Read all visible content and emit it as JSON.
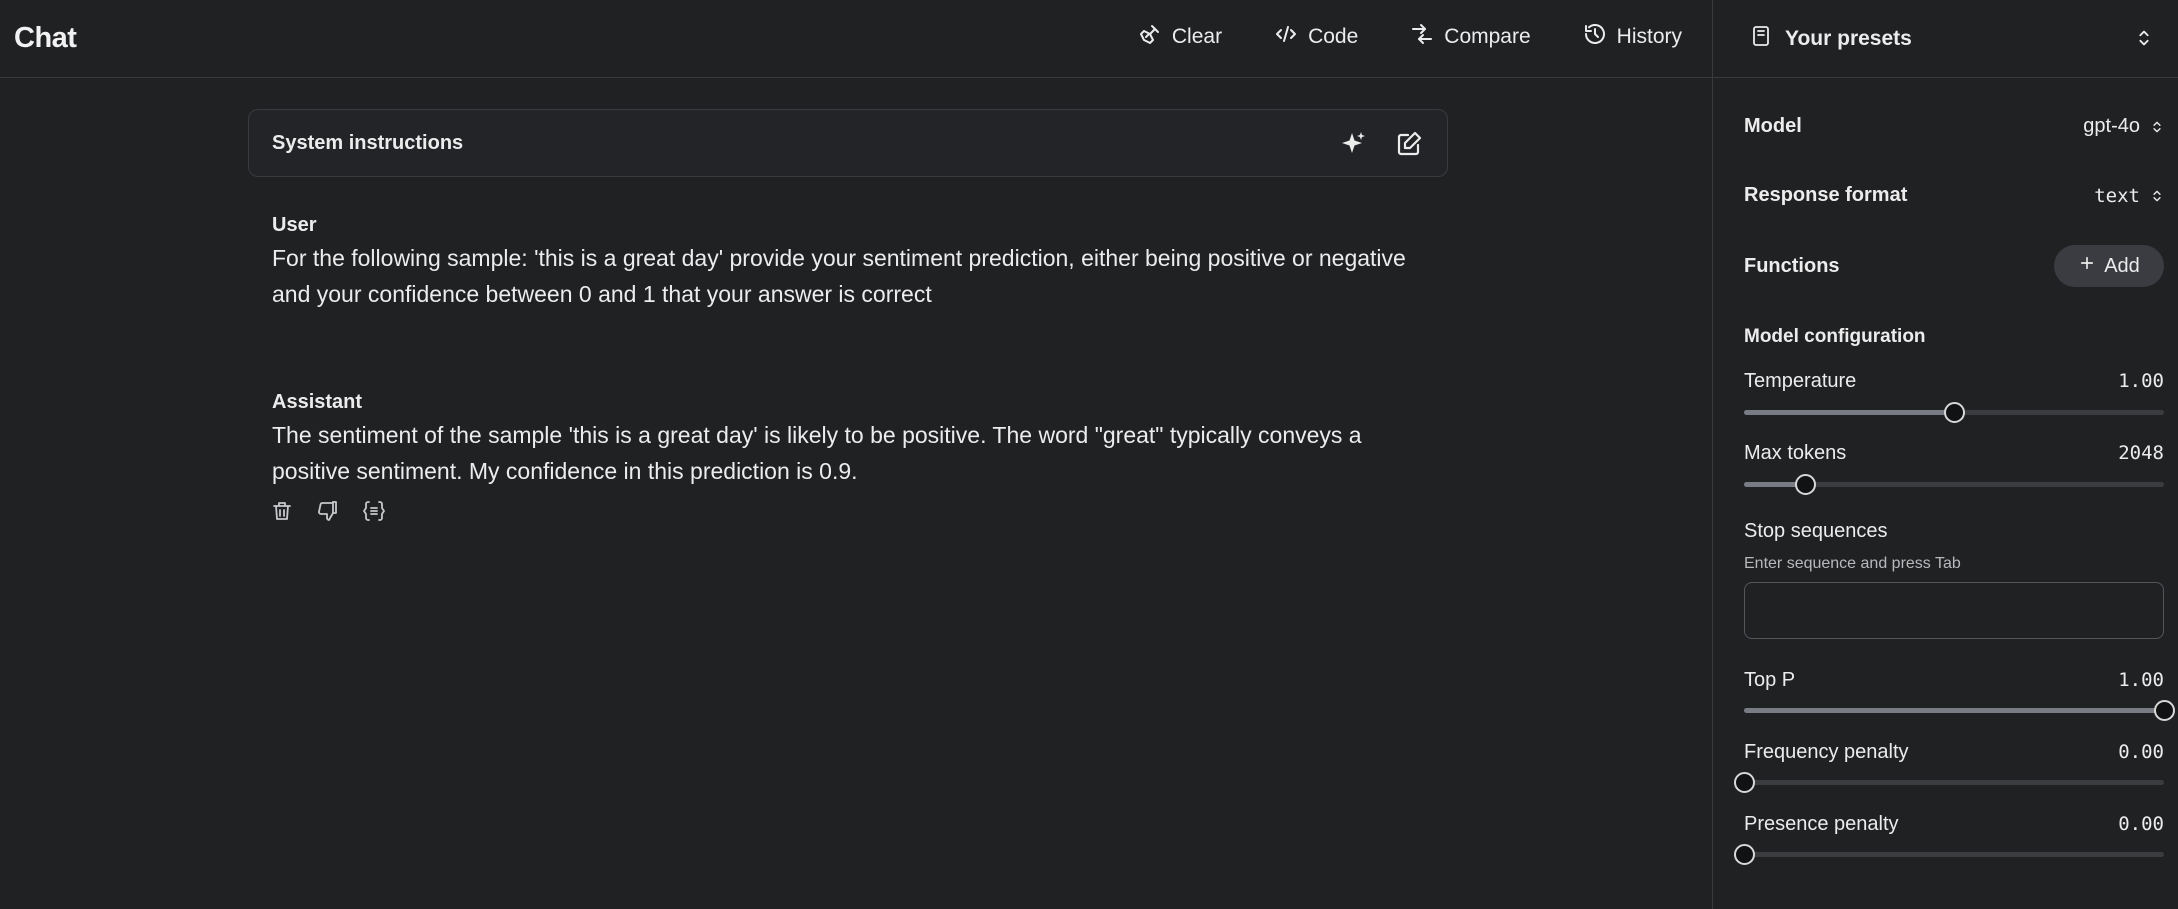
{
  "header": {
    "title": "Chat",
    "actions": {
      "clear": "Clear",
      "code": "Code",
      "compare": "Compare",
      "history": "History"
    }
  },
  "system": {
    "label": "System instructions"
  },
  "messages": [
    {
      "role": "User",
      "text": "For the following sample: 'this is a great day' provide your sentiment prediction, either being positive or negative and your confidence between 0 and 1 that your answer is correct"
    },
    {
      "role": "Assistant",
      "text": "The sentiment of the sample 'this is a great day' is likely to be positive. The word \"great\" typically conveys a positive sentiment. My confidence in this prediction is 0.9."
    }
  ],
  "sidebar": {
    "presets_label": "Your presets",
    "model_label": "Model",
    "model_value": "gpt-4o",
    "response_format_label": "Response format",
    "response_format_value": "text",
    "functions_label": "Functions",
    "add_label": "Add",
    "config_title": "Model configuration",
    "params": {
      "temperature": {
        "label": "Temperature",
        "value": "1.00",
        "fraction": 0.5
      },
      "max_tokens": {
        "label": "Max tokens",
        "value": "2048",
        "fraction": 0.145
      },
      "top_p": {
        "label": "Top P",
        "value": "1.00",
        "fraction": 1.0
      },
      "frequency_penalty": {
        "label": "Frequency penalty",
        "value": "0.00",
        "fraction": 0.0
      },
      "presence_penalty": {
        "label": "Presence penalty",
        "value": "0.00",
        "fraction": 0.0
      }
    },
    "stop_sequences_label": "Stop sequences",
    "stop_sequences_hint": "Enter sequence and press Tab",
    "stop_sequences_value": ""
  },
  "colors": {
    "background": "#202123",
    "border": "#3a3b3f",
    "text": "#ececec",
    "button": "#3a3c42"
  }
}
